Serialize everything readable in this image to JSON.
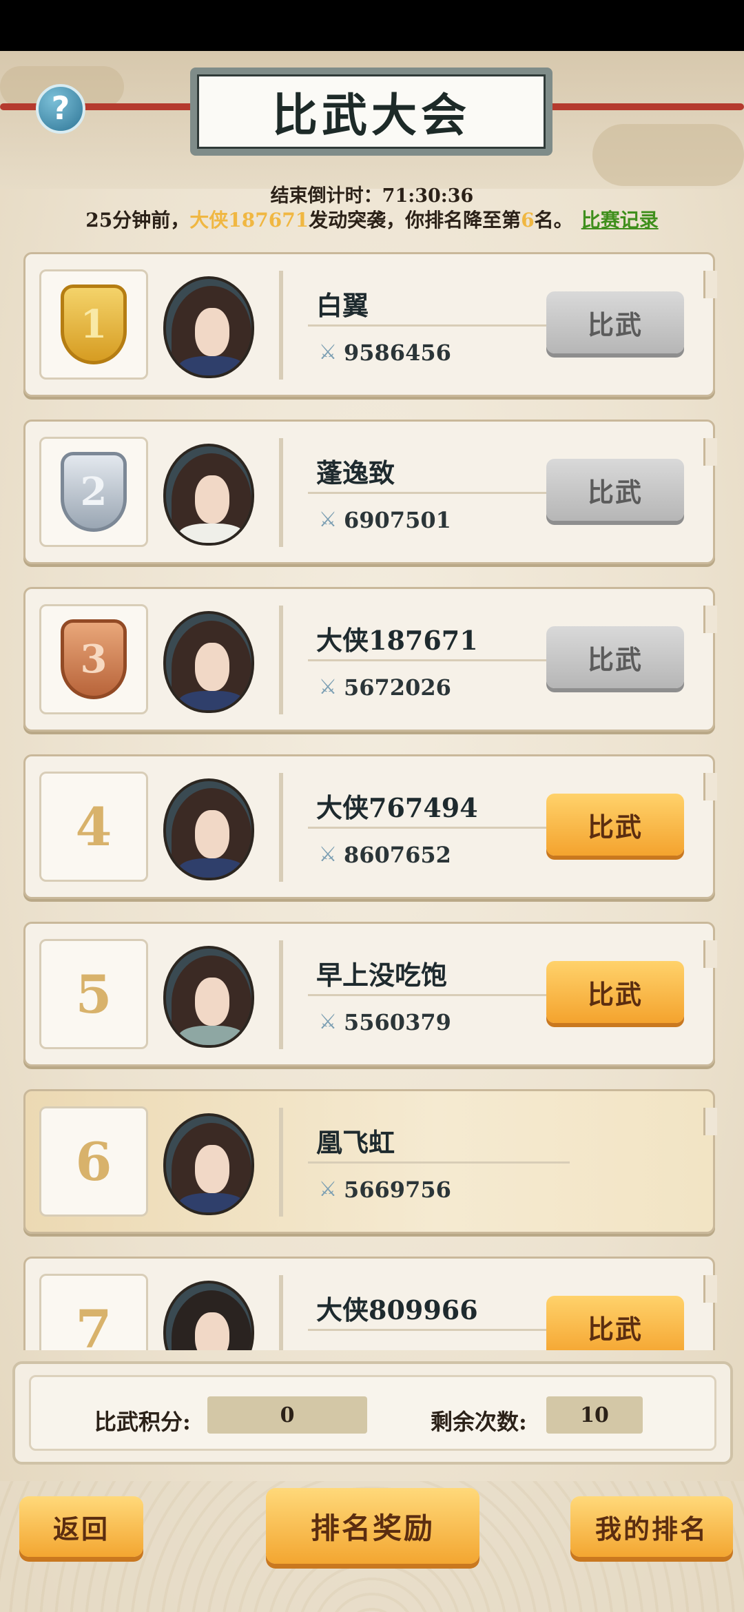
{
  "header": {
    "title": "比武大会",
    "help_icon": "question-icon",
    "countdown_label": "结束倒计时：",
    "countdown_value": "71:30:36",
    "notice_prefix": "25分钟前，",
    "notice_attacker": "大侠187671",
    "notice_middle": "发动突袭，你排名降至第",
    "notice_rank": "6",
    "notice_suffix": "名。",
    "record_link": "比赛记录"
  },
  "colors": {
    "highlight": "#f0b742",
    "link": "#3f8f1c",
    "button_active": "#f4a32e",
    "button_disabled": "#b6b6b6"
  },
  "rankings": [
    {
      "rank": "1",
      "medal": "gold",
      "name": "白翼",
      "power": "9586456",
      "button": "比武",
      "button_state": "disabled",
      "avatar": "female"
    },
    {
      "rank": "2",
      "medal": "silver",
      "name": "蓬逸致",
      "power": "6907501",
      "button": "比武",
      "button_state": "disabled",
      "avatar": "white"
    },
    {
      "rank": "3",
      "medal": "bronze",
      "name": "大侠187671",
      "power": "5672026",
      "button": "比武",
      "button_state": "disabled",
      "avatar": "female"
    },
    {
      "rank": "4",
      "medal": "",
      "name": "大侠767494",
      "power": "8607652",
      "button": "比武",
      "button_state": "active",
      "avatar": "female"
    },
    {
      "rank": "5",
      "medal": "",
      "name": "早上没吃饱",
      "power": "5560379",
      "button": "比武",
      "button_state": "active",
      "avatar": "green"
    },
    {
      "rank": "6",
      "medal": "",
      "name": "凰飞虹",
      "power": "5669756",
      "button": "",
      "button_state": "self",
      "avatar": "female"
    },
    {
      "rank": "7",
      "medal": "",
      "name": "大侠809966",
      "power": "",
      "button": "比武",
      "button_state": "active",
      "avatar": "red"
    }
  ],
  "score_panel": {
    "points_label": "比武积分:",
    "points_value": "0",
    "remaining_label": "剩余次数:",
    "remaining_value": "10"
  },
  "footer": {
    "back": "返回",
    "rank_rewards": "排名奖励",
    "my_rank": "我的排名"
  }
}
